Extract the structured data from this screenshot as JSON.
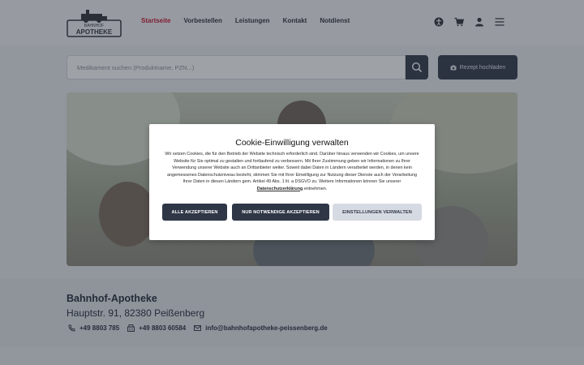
{
  "header": {
    "logo_text_top": "BAHNHOF",
    "logo_text_main": "APOTHEKE",
    "nav": [
      {
        "label": "Startseite",
        "active": true
      },
      {
        "label": "Vorbestellen",
        "active": false
      },
      {
        "label": "Leistungen",
        "active": false
      },
      {
        "label": "Kontakt",
        "active": false
      },
      {
        "label": "Notdienst",
        "active": false
      }
    ],
    "icons": [
      "accessibility-icon",
      "cart-icon",
      "user-icon",
      "menu-icon"
    ]
  },
  "search": {
    "placeholder": "Medikament suchen (Produktname, PZN...)",
    "upload_label": "Rezept hochladen"
  },
  "cookie_modal": {
    "title": "Cookie-Einwilligung verwalten",
    "body": "Wir setzen Cookies, die für den Betrieb der Website technisch erforderlich sind. Darüber hinaus verwenden wir Cookies, um unsere Website für Sie optimal zu gestalten und fortlaufend zu verbessern. Mit Ihrer Zustimmung geben wir Informationen zu Ihrer Verwendung unserer Website auch an Drittanbieter weiter. Soweit dabei Daten in Ländern verarbeitet werden, in denen kein angemessenes Datenschutzniveau besteht, stimmen Sie mit Ihrer Einwilligung zur Nutzung dieser Dienste auch der Verarbeitung Ihrer Daten in diesen Ländern gem. Artikel 49 Abs. 1 lit. a DSGVO zu. Weitere Informationen können Sie unserer",
    "link": "Datenschutzerklärung",
    "body_end": "entnehmen.",
    "buttons": {
      "accept_all": "ALLE AKZEPTIEREN",
      "necessary": "NUR NOTWENDIGE AKZEPTIEREN",
      "settings": "EINSTELLUNGEN VERWALTEN"
    }
  },
  "footer": {
    "name": "Bahnhof-Apotheke",
    "address": "Hauptstr. 91, 82380 Peißenberg",
    "phone": "+49 8803 785",
    "fax": "+49 8803 60584",
    "email": "info@bahnhofapotheke-peissenberg.de"
  },
  "colors": {
    "primary": "#2f3747",
    "accent": "#c8102e"
  }
}
